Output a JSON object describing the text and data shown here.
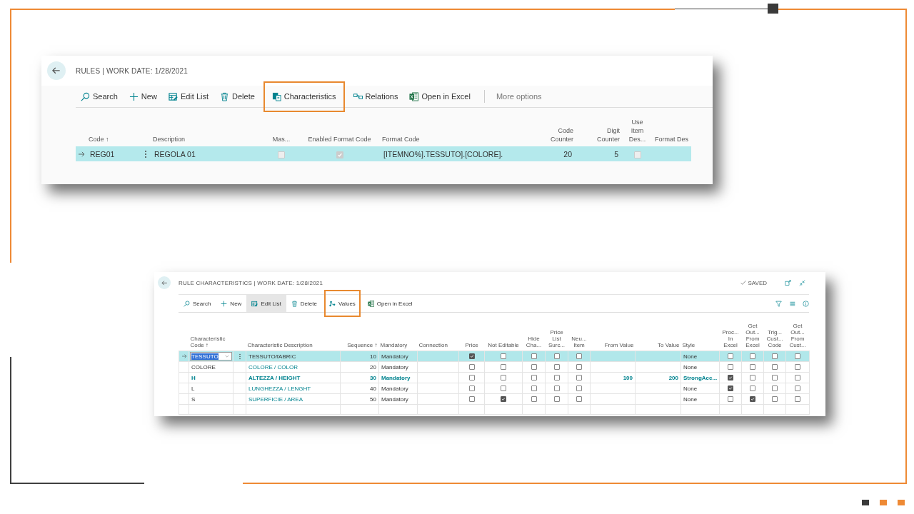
{
  "screens": [
    {
      "kind": "page",
      "title": "RULES | WORK DATE: 1/28/2021",
      "actions": [
        {
          "kind": "search",
          "label": "Search",
          "highlighted": false,
          "active": false
        },
        {
          "kind": "new",
          "label": "New",
          "highlighted": false,
          "active": false
        },
        {
          "kind": "edit-list",
          "label": "Edit List",
          "highlighted": false,
          "active": false
        },
        {
          "kind": "delete",
          "label": "Delete",
          "highlighted": false,
          "active": false
        },
        {
          "kind": "characteristics",
          "label": "Characteristics",
          "highlighted": true,
          "active": false
        },
        {
          "kind": "relations",
          "label": "Relations",
          "highlighted": false,
          "active": false
        },
        {
          "kind": "excel",
          "label": "Open in Excel",
          "highlighted": false,
          "active": false
        },
        {
          "kind": "more",
          "label": "More options",
          "highlighted": false,
          "active": false
        }
      ],
      "columns": [
        {
          "lines": [
            "Code ↑"
          ],
          "kind": "text"
        },
        {
          "lines": [
            "Description"
          ],
          "kind": "text"
        },
        {
          "lines": [
            "Mas..."
          ],
          "kind": "check",
          "disabled": true
        },
        {
          "lines": [
            "Enabled Format Code"
          ],
          "kind": "check",
          "disabled": true
        },
        {
          "lines": [
            "Format Code"
          ],
          "kind": "text"
        },
        {
          "lines": [
            "Code",
            "Counter"
          ],
          "kind": "number"
        },
        {
          "lines": [
            "Digit",
            "Counter"
          ],
          "kind": "number"
        },
        {
          "lines": [
            "Use",
            "Item",
            "Des..."
          ],
          "kind": "check",
          "disabled": true
        },
        {
          "lines": [
            "Format Des"
          ],
          "kind": "text"
        }
      ],
      "rows": [
        {
          "selected": true,
          "editing": false,
          "bold": false,
          "cells": [
            "REG01",
            "REGOLA 01",
            false,
            true,
            "[ITEMNO%].TESSUTO].[COLORE].",
            "20",
            "5",
            false,
            null
          ]
        }
      ]
    },
    {
      "kind": "subpage",
      "title": "RULE CHARACTERISTICS | WORK DATE: 1/28/2021",
      "status": "SAVED",
      "actions": [
        {
          "kind": "search",
          "label": "Search",
          "highlighted": false,
          "active": false
        },
        {
          "kind": "new",
          "label": "New",
          "highlighted": false,
          "active": false
        },
        {
          "kind": "edit-list",
          "label": "Edit List",
          "highlighted": false,
          "active": true
        },
        {
          "kind": "delete",
          "label": "Delete",
          "highlighted": false,
          "active": false
        },
        {
          "kind": "values",
          "label": "Values",
          "highlighted": true,
          "active": false
        },
        {
          "kind": "excel",
          "label": "Open in Excel",
          "highlighted": false,
          "active": false
        }
      ],
      "columns": [
        {
          "lines": [
            "Characteristic",
            "Code ↑"
          ],
          "kind": "text"
        },
        {
          "lines": [
            "Characteristic Description"
          ],
          "kind": "link"
        },
        {
          "lines": [
            "Sequence ↑"
          ],
          "kind": "number"
        },
        {
          "lines": [
            "Mandatory"
          ],
          "kind": "text"
        },
        {
          "lines": [
            "Connection"
          ],
          "kind": "text"
        },
        {
          "lines": [
            "Price"
          ],
          "kind": "check",
          "disabled": false
        },
        {
          "lines": [
            "Not Editable"
          ],
          "kind": "check",
          "disabled": false
        },
        {
          "lines": [
            "Hide",
            "Cha..."
          ],
          "kind": "check",
          "disabled": false
        },
        {
          "lines": [
            "Price",
            "List",
            "Surc..."
          ],
          "kind": "check",
          "disabled": false
        },
        {
          "lines": [
            "Neu...",
            "Item"
          ],
          "kind": "check",
          "disabled": false
        },
        {
          "lines": [
            "From Value"
          ],
          "kind": "number"
        },
        {
          "lines": [
            "To Value"
          ],
          "kind": "number"
        },
        {
          "lines": [
            "Style"
          ],
          "kind": "text"
        },
        {
          "lines": [
            "Proc...",
            "In",
            "Excel"
          ],
          "kind": "check",
          "disabled": false
        },
        {
          "lines": [
            "Get",
            "Out...",
            "From",
            "Excel"
          ],
          "kind": "check",
          "disabled": false
        },
        {
          "lines": [
            "Trig...",
            "Cust...",
            "Code"
          ],
          "kind": "check",
          "disabled": false
        },
        {
          "lines": [
            "Get",
            "Out...",
            "From",
            "Cust..."
          ],
          "kind": "check",
          "disabled": false
        }
      ],
      "rows": [
        {
          "selected": true,
          "editing": true,
          "bold": false,
          "cells": [
            "TESSUTO",
            "TESSUTO/fABRIC",
            "10",
            "Mandatory",
            null,
            true,
            false,
            false,
            false,
            false,
            null,
            null,
            "None",
            false,
            false,
            false,
            false
          ]
        },
        {
          "selected": false,
          "editing": false,
          "bold": false,
          "cells": [
            "COLORE",
            "COLORE / COLOR",
            "20",
            "Mandatory",
            null,
            false,
            false,
            false,
            false,
            false,
            null,
            null,
            "None",
            false,
            false,
            false,
            false
          ]
        },
        {
          "selected": false,
          "editing": false,
          "bold": true,
          "cells": [
            "H",
            "ALTEZZA / HEIGHT",
            "30",
            "Mandatory",
            null,
            false,
            false,
            false,
            false,
            false,
            "100",
            "200",
            "StrongAcc...",
            true,
            false,
            false,
            false
          ]
        },
        {
          "selected": false,
          "editing": false,
          "bold": false,
          "cells": [
            "L",
            "LUNGHEZZA / LENGHT",
            "40",
            "Mandatory",
            null,
            false,
            false,
            false,
            false,
            false,
            null,
            null,
            "None",
            true,
            false,
            false,
            false
          ]
        },
        {
          "selected": false,
          "editing": false,
          "bold": false,
          "cells": [
            "S",
            "SUPERFICIE / AREA",
            "50",
            "Mandatory",
            null,
            false,
            true,
            false,
            false,
            false,
            null,
            null,
            "None",
            false,
            true,
            false,
            false
          ]
        }
      ]
    }
  ]
}
